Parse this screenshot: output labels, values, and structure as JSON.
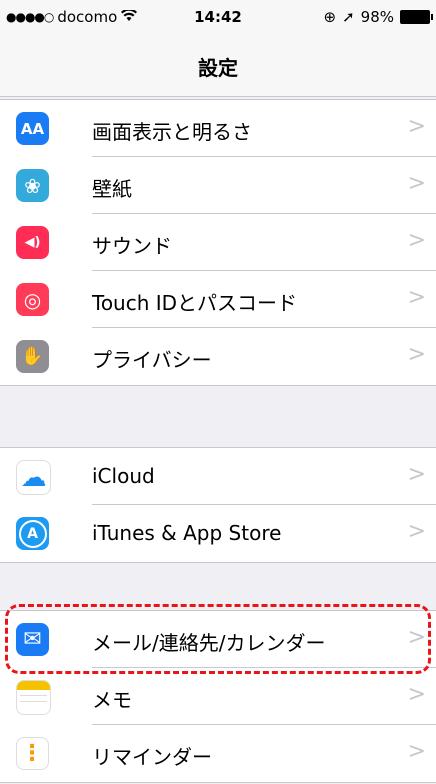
{
  "status_bar": {
    "signal": "●●●●○",
    "carrier": "docomo",
    "wifi_icon": "wifi-icon",
    "time": "14:42",
    "lock_icon": "⊕",
    "location_icon": "➚",
    "battery": "98%"
  },
  "nav": {
    "title": "設定"
  },
  "groups": [
    {
      "items": [
        {
          "label": "画面表示と明るさ",
          "icon": "display-brightness-icon",
          "icon_text": "AA",
          "color": "#1a7cf5"
        },
        {
          "label": "壁紙",
          "icon": "wallpaper-icon",
          "icon_text": "❀",
          "color": "#34aadc"
        },
        {
          "label": "サウンド",
          "icon": "sound-icon",
          "icon_text": "◀)",
          "color": "#ff2d55"
        },
        {
          "label": "Touch IDとパスコード",
          "icon": "fingerprint-icon",
          "icon_text": "◎",
          "color": "#ff3b58"
        },
        {
          "label": "プライバシー",
          "icon": "hand-icon",
          "icon_text": "✋",
          "color": "#8e8e93"
        }
      ]
    },
    {
      "items": [
        {
          "label": "iCloud",
          "icon": "icloud-icon",
          "icon_text": "☁",
          "color": "#ffffff"
        },
        {
          "label": "iTunes & App Store",
          "icon": "app-store-icon",
          "icon_text": "A",
          "color": "#1d9bf0"
        }
      ]
    },
    {
      "items": [
        {
          "label": "メール/連絡先/カレンダー",
          "icon": "mail-icon",
          "icon_text": "✉",
          "color": "#1a7cf5"
        },
        {
          "label": "メモ",
          "icon": "notes-icon",
          "icon_text": "",
          "color": "#ffffff"
        },
        {
          "label": "リマインダー",
          "icon": "reminders-icon",
          "icon_text": "⋮",
          "color": "#ffffff"
        }
      ]
    }
  ],
  "chevron": ">"
}
